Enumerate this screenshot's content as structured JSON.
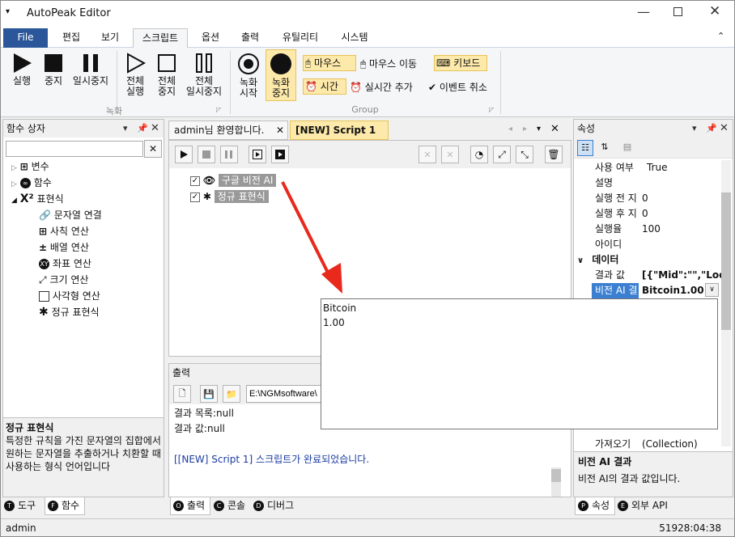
{
  "app": {
    "title": "AutoPeak Editor"
  },
  "menu": {
    "file": "File",
    "tabs": [
      "편집",
      "보기",
      "스크립트",
      "옵션",
      "출력",
      "유틸리티",
      "시스템"
    ]
  },
  "ribbon": {
    "run": "실행",
    "stop": "중지",
    "pause": "일시중지",
    "all_run": [
      "전체",
      "실행"
    ],
    "all_stop": [
      "전체",
      "중지"
    ],
    "all_pause": [
      "전체",
      "일시중지"
    ],
    "group1_label": "녹화",
    "rec_start": [
      "녹화",
      "시작"
    ],
    "rec_stop": [
      "녹화",
      "중지"
    ],
    "mouse": "마우스",
    "mouse_move": "마우스 이동",
    "keyboard": "키보드",
    "time": "시간",
    "realtime_add": "실시간 추가",
    "event_cancel": "이벤트 취소",
    "group2_label": "Group"
  },
  "func_panel": {
    "title": "함수 상자",
    "search_value": "",
    "items": [
      "변수",
      "함수",
      "표현식",
      "문자열 연결",
      "사칙 연산",
      "배열 연산",
      "좌표 연산",
      "크기 연산",
      "사각형 연산",
      "정규 표현식"
    ],
    "desc_title": "정규 표현식",
    "desc_text": "특정한 규칙을 가진 문자열의 집합에서 원하는 문자열을 추출하거나 치환할 때 사용하는 형식 언어입니다",
    "tab_tools": "도구",
    "tab_funcs": "함수"
  },
  "doc_tabs": {
    "welcome": "admin님 환영합니다.",
    "script": "[NEW] Script 1"
  },
  "script_nodes": [
    {
      "label": "구글 비전 AI"
    },
    {
      "label": "정규 표현식"
    }
  ],
  "output_panel": {
    "title": "출력",
    "path": "E:\\NGMsoftware\\",
    "lines": [
      "결과 목록:null",
      "결과 값:null"
    ],
    "done": "[[NEW] Script 1] 스크립트가 완료되었습니다.",
    "tab_output": "출력",
    "tab_console": "콘솔",
    "tab_debug": "디버그"
  },
  "popup": {
    "line1": "Bitcoin",
    "line2": "1.00"
  },
  "props_panel": {
    "title": "속성",
    "rows": [
      {
        "k": "사용 여부",
        "v": "True"
      },
      {
        "k": "설명",
        "v": ""
      },
      {
        "k": "실행 전 지",
        "v": "0"
      },
      {
        "k": "실행 후 지",
        "v": "0"
      },
      {
        "k": "실행율",
        "v": "100"
      },
      {
        "k": "아이디",
        "v": ""
      }
    ],
    "cat_data": "데이터",
    "data_rows": [
      {
        "k": "결과 값",
        "v": "[{\"Mid\":\"\",\"Local"
      },
      {
        "k": "비전 AI 결",
        "v": "Bitcoin1.00"
      }
    ],
    "bottom_rows": [
      {
        "k": "가져오기",
        "v": "(Collection)"
      }
    ],
    "desc_title": "비전 AI 결과",
    "desc_text": "비전 AI의 결과 값입니다.",
    "tab_props": "속성",
    "tab_api": "외부 API"
  },
  "status": {
    "user": "admin",
    "time": "51928:04:38"
  },
  "colors": {
    "accent": "#2b579a",
    "highlight": "#fde9a9",
    "selected": "#3c7fd1",
    "arrow": "#e8291c"
  }
}
